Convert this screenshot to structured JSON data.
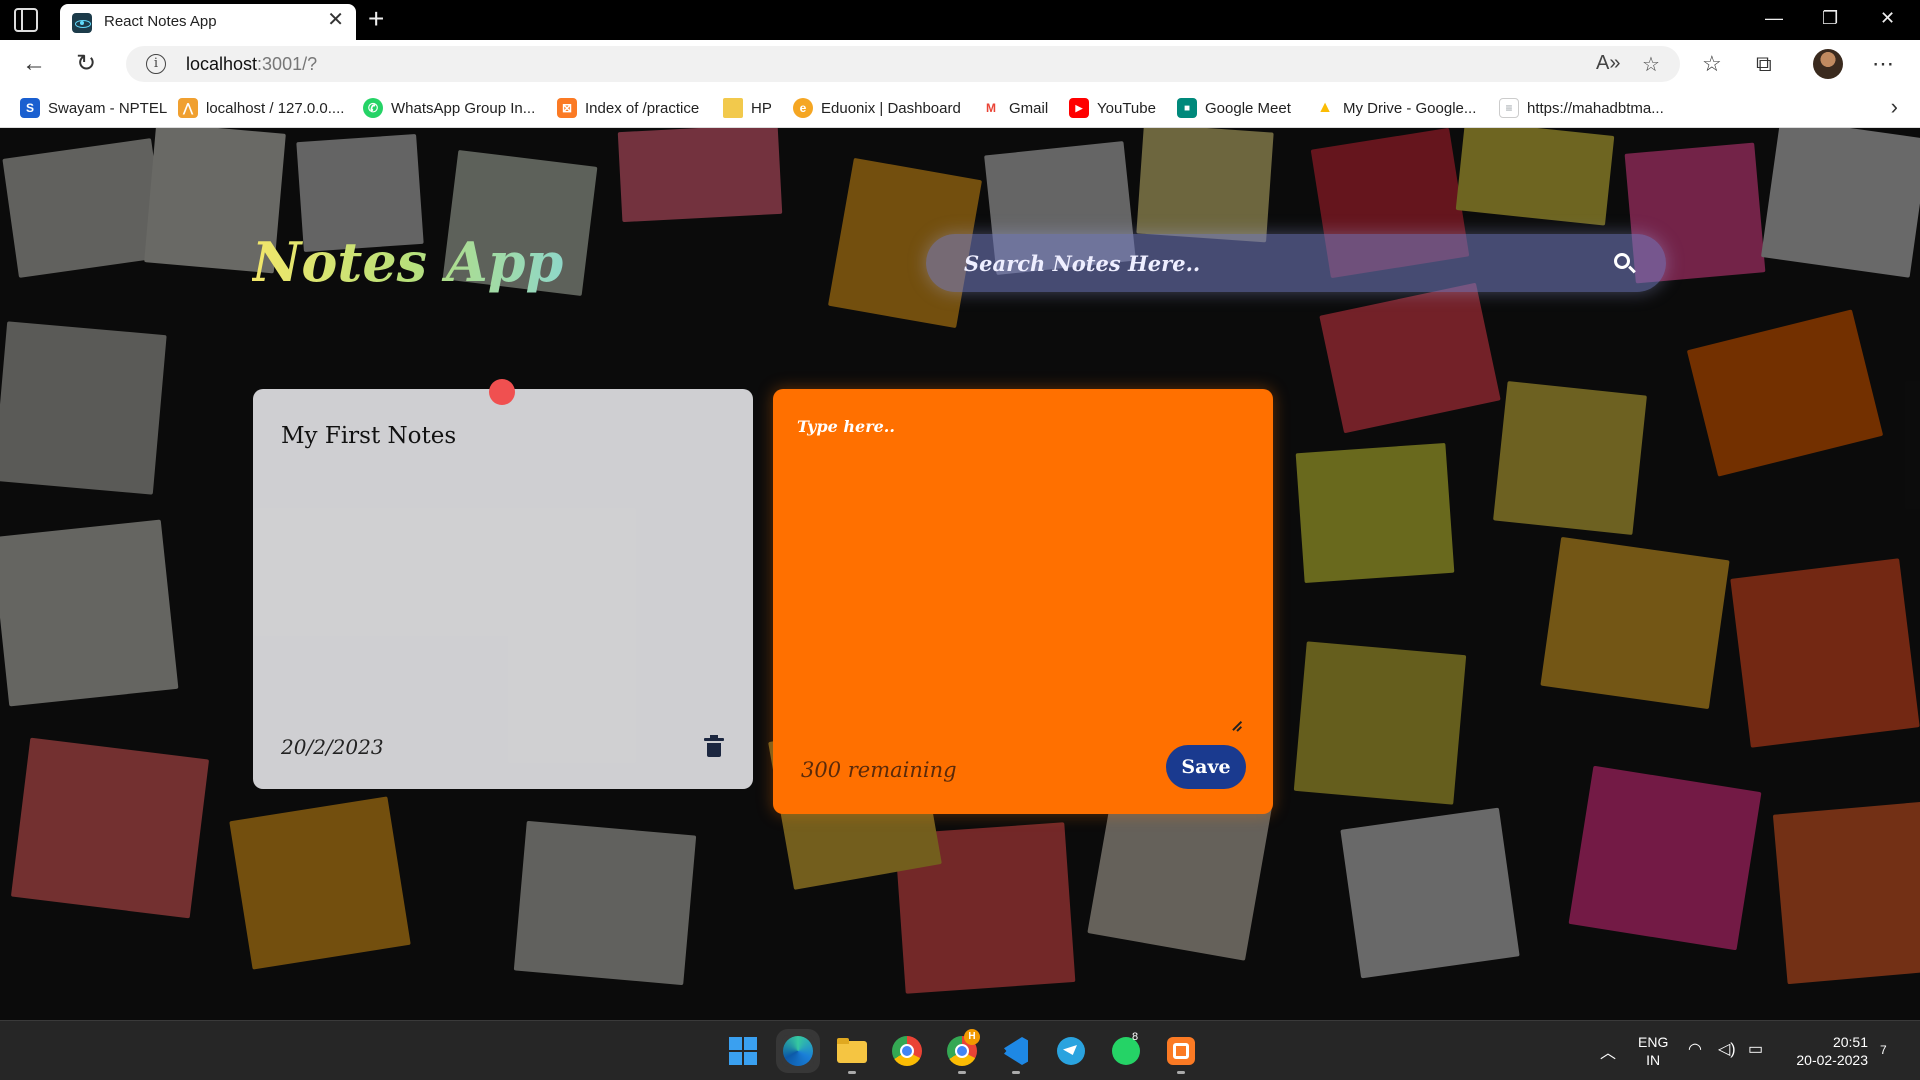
{
  "browser": {
    "tab_title": "React Notes App",
    "tab_close": "✕",
    "new_tab": "+",
    "window_controls": {
      "minimize": "—",
      "restore": "❐",
      "close": "✕"
    },
    "url_host": "localhost",
    "url_path": ":3001/?",
    "bookmarks": [
      {
        "label": "Swayam - NPTEL",
        "icon": "swayam-icon",
        "color": "#1a5fd0",
        "glyph": "S"
      },
      {
        "label": "localhost / 127.0.0....",
        "icon": "phpmyadmin-icon",
        "color": "#f0a030",
        "glyph": "⋀"
      },
      {
        "label": "WhatsApp Group In...",
        "icon": "whatsapp-icon",
        "color": "#25d366",
        "glyph": "✆"
      },
      {
        "label": "Index of /practice",
        "icon": "xampp-icon",
        "color": "#fb7a24",
        "glyph": "⊠"
      },
      {
        "label": "HP",
        "icon": "folder-icon",
        "color": "#f2c94c",
        "glyph": ""
      },
      {
        "label": "Eduonix | Dashboard",
        "icon": "eduonix-icon",
        "color": "#f5a623",
        "glyph": "e"
      },
      {
        "label": "Gmail",
        "icon": "gmail-icon",
        "color": "#ea4335",
        "glyph": "M"
      },
      {
        "label": "YouTube",
        "icon": "youtube-icon",
        "color": "#ff0000",
        "glyph": "▶"
      },
      {
        "label": "Google Meet",
        "icon": "google-meet-icon",
        "color": "#00897b",
        "glyph": "■"
      },
      {
        "label": "My Drive - Google...",
        "icon": "google-drive-icon",
        "color": "#fbbc04",
        "glyph": "▲"
      },
      {
        "label": "https://mahadbtma...",
        "icon": "document-icon",
        "color": "#9aa0a6",
        "glyph": "≡"
      }
    ]
  },
  "app": {
    "title": "Notes App",
    "search_placeholder": "Search Notes Here..",
    "notes": [
      {
        "text": "My First Notes",
        "date": "20/2/2023"
      }
    ],
    "new_note": {
      "placeholder": "Type here..",
      "remaining": "300 remaining",
      "save_label": "Save"
    }
  },
  "taskbar": {
    "apps": [
      "windows-start-icon",
      "edge-icon",
      "file-explorer-icon",
      "chrome-icon",
      "chrome-profile-icon",
      "vscode-icon",
      "telegram-icon",
      "whatsapp-icon",
      "xampp-icon"
    ],
    "language": "ENG",
    "region": "IN",
    "time": "20:51",
    "date": "20-02-2023",
    "notification_count": "7",
    "whatsapp_badge": "8",
    "chrome_badge": "H"
  }
}
